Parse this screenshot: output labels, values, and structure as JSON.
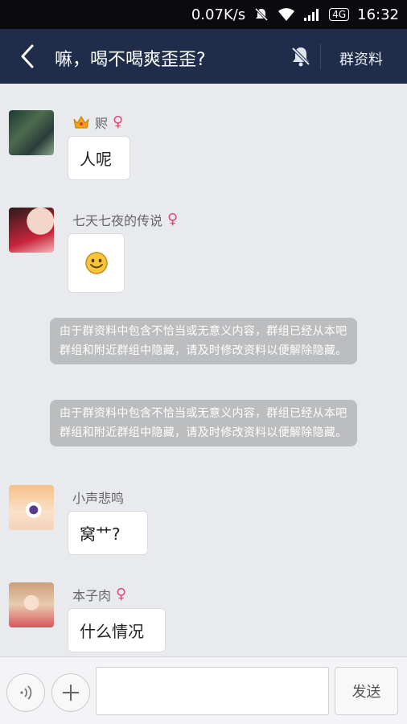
{
  "status_bar": {
    "net_speed": "0.07K/s",
    "network_badge": "4G",
    "time": "16:32"
  },
  "header": {
    "title": "嘛，喝不喝爽歪歪?",
    "group_info_label": "群资料"
  },
  "messages": [
    {
      "sender": "赆",
      "gender_symbol": "♀",
      "text": "人呢"
    },
    {
      "sender": "七天七夜的传说",
      "gender_symbol": "♀",
      "content_icon": "smiley-emoji"
    },
    {
      "system_notice": "由于群资料中包含不恰当或无意义内容，群组已经从本吧群组和附近群组中隐藏，请及时修改资料以便解除隐藏。"
    },
    {
      "system_notice": "由于群资料中包含不恰当或无意义内容，群组已经从本吧群组和附近群组中隐藏，请及时修改资料以便解除隐藏。"
    },
    {
      "sender": "小声悲鸣",
      "text": "窝艹?"
    },
    {
      "sender": "本子肉",
      "gender_symbol": "♀",
      "text": "什么情况"
    }
  ],
  "input_bar": {
    "send_label": "发送",
    "input_value": ""
  },
  "colors": {
    "header_bg": "#1f2d4b",
    "chat_bg": "#e8eaed",
    "female_icon": "#e24874",
    "notice_bg": "#bcbdbf"
  }
}
